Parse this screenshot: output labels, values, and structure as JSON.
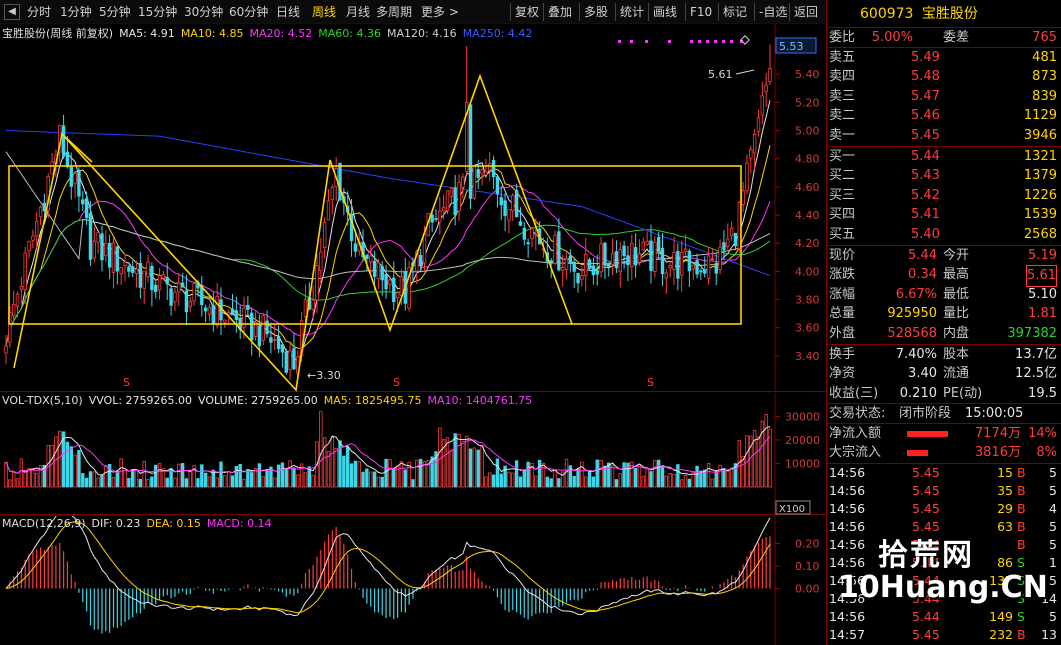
{
  "toolbar": {
    "items": [
      {
        "label": "分时",
        "active": false
      },
      {
        "label": "1分钟",
        "active": false
      },
      {
        "label": "5分钟",
        "active": false
      },
      {
        "label": "15分钟",
        "active": false
      },
      {
        "label": "30分钟",
        "active": false
      },
      {
        "label": "60分钟",
        "active": false
      },
      {
        "label": "日线",
        "active": false
      },
      {
        "label": "周线",
        "active": true
      },
      {
        "label": "月线",
        "active": false
      },
      {
        "label": "多周期",
        "active": false
      },
      {
        "label": "更多 >",
        "active": false
      }
    ],
    "right_items": [
      "复权",
      "叠加",
      "多股",
      "统计",
      "画线",
      "F10",
      "标记",
      "-自选",
      "返回"
    ]
  },
  "kline": {
    "legend": [
      {
        "text": "宝胜股份(周线 前复权)",
        "color": "#e0e0e0"
      },
      {
        "text": "MA5: 4.91",
        "color": "#e6e6e6"
      },
      {
        "text": "MA10: 4.85",
        "color": "#ffd400"
      },
      {
        "text": "MA20: 4.52",
        "color": "#ff33ff"
      },
      {
        "text": "MA60: 4.36",
        "color": "#2cd12c"
      },
      {
        "text": "MA120: 4.16",
        "color": "#d0d0d0"
      },
      {
        "text": "MA250: 4.42",
        "color": "#3a5bff"
      }
    ],
    "yticks": [
      "5.40",
      "5.20",
      "5.00",
      "4.80",
      "4.60",
      "4.40",
      "4.20",
      "4.00",
      "3.80",
      "3.60",
      "3.40"
    ],
    "last_price_tag": "5.53",
    "high_label": "5.61",
    "low_label": "3.30",
    "s_marker": "S"
  },
  "volume": {
    "legend": [
      {
        "text": "VOL-TDX(5,10)",
        "color": "#e0e0e0"
      },
      {
        "text": "VVOL: 2759265.00",
        "color": "#e6e6e6"
      },
      {
        "text": "VOLUME: 2759265.00",
        "color": "#e6e6e6"
      },
      {
        "text": "MA5: 1825495.75",
        "color": "#ffd400"
      },
      {
        "text": "MA10: 1404761.75",
        "color": "#ff33ff"
      }
    ],
    "yticks": [
      "30000",
      "20000",
      "10000"
    ],
    "unit": "X100"
  },
  "macd": {
    "legend": [
      {
        "text": "MACD(12,26,9)",
        "color": "#e0e0e0"
      },
      {
        "text": "DIF: 0.23",
        "color": "#e6e6e6"
      },
      {
        "text": "DEA: 0.15",
        "color": "#ffd400"
      },
      {
        "text": "MACD: 0.14",
        "color": "#ff33ff"
      }
    ],
    "yticks": [
      "0.20",
      "0.10",
      "0.00"
    ]
  },
  "quote": {
    "code": "600973",
    "name": "宝胜股份",
    "weibi_label": "委比",
    "weibi": "5.00%",
    "weicha_label": "委差",
    "weicha": "765",
    "sell": [
      {
        "label": "卖五",
        "price": "5.49",
        "vol": "481"
      },
      {
        "label": "卖四",
        "price": "5.48",
        "vol": "873"
      },
      {
        "label": "卖三",
        "price": "5.47",
        "vol": "839"
      },
      {
        "label": "卖二",
        "price": "5.46",
        "vol": "1129"
      },
      {
        "label": "卖一",
        "price": "5.45",
        "vol": "3946"
      }
    ],
    "buy": [
      {
        "label": "买一",
        "price": "5.44",
        "vol": "1321"
      },
      {
        "label": "买二",
        "price": "5.43",
        "vol": "1379"
      },
      {
        "label": "买三",
        "price": "5.42",
        "vol": "1226"
      },
      {
        "label": "买四",
        "price": "5.41",
        "vol": "1539"
      },
      {
        "label": "买五",
        "price": "5.40",
        "vol": "2568"
      }
    ],
    "stats": [
      {
        "l1": "现价",
        "v1": "5.44",
        "c1": "red",
        "l2": "今开",
        "v2": "5.19",
        "c2": "red"
      },
      {
        "l1": "涨跌",
        "v1": "0.34",
        "c1": "red",
        "l2": "最高",
        "v2": "5.61",
        "c2": "red"
      },
      {
        "l1": "涨幅",
        "v1": "6.67%",
        "c1": "red",
        "l2": "最低",
        "v2": "5.10",
        "c2": "white"
      },
      {
        "l1": "总量",
        "v1": "925950",
        "c1": "yellow",
        "l2": "量比",
        "v2": "1.81",
        "c2": "red"
      },
      {
        "l1": "外盘",
        "v1": "528568",
        "c1": "red",
        "l2": "内盘",
        "v2": "397382",
        "c2": "green"
      }
    ],
    "fund": [
      {
        "l1": "换手",
        "v1": "7.40%",
        "l2": "股本",
        "v2": "13.7亿"
      },
      {
        "l1": "净资",
        "v1": "3.40",
        "l2": "流通",
        "v2": "12.5亿"
      },
      {
        "l1": "收益(三)",
        "v1": "0.210",
        "l2": "PE(动)",
        "v2": "19.5"
      }
    ],
    "trade_status_label": "交易状态:",
    "trade_status": "闭市阶段",
    "trade_time": "15:00:05",
    "flows": [
      {
        "label": "净流入额",
        "amount": "7174万",
        "pct": "14%",
        "bar": 0.9
      },
      {
        "label": "大宗流入",
        "amount": "3816万",
        "pct": "8%",
        "bar": 0.45
      }
    ],
    "ticks": [
      {
        "time": "14:56",
        "price": "5.45",
        "vol": "15",
        "side": "B",
        "n": "5"
      },
      {
        "time": "14:56",
        "price": "5.45",
        "vol": "35",
        "side": "B",
        "n": "5"
      },
      {
        "time": "14:56",
        "price": "5.45",
        "vol": "29",
        "side": "B",
        "n": "4"
      },
      {
        "time": "14:56",
        "price": "5.45",
        "vol": "63",
        "side": "B",
        "n": "5"
      },
      {
        "time": "14:56",
        "price": "5.44",
        "vol": "",
        "side": "B",
        "n": "5"
      },
      {
        "time": "14:56",
        "price": "5.44",
        "vol": "86",
        "side": "S",
        "n": "1"
      },
      {
        "time": "14:56",
        "price": "5.44",
        "vol": "137",
        "side": "S",
        "n": "5"
      },
      {
        "time": "14:56",
        "price": "5.44",
        "vol": "",
        "side": "S",
        "n": "14"
      },
      {
        "time": "14:56",
        "price": "5.44",
        "vol": "149",
        "side": "S",
        "n": "5"
      },
      {
        "time": "14:57",
        "price": "5.45",
        "vol": "232",
        "side": "B",
        "n": "13"
      }
    ]
  },
  "watermark": {
    "top": "拾荒网",
    "bottom": "10Huang.CN"
  }
}
